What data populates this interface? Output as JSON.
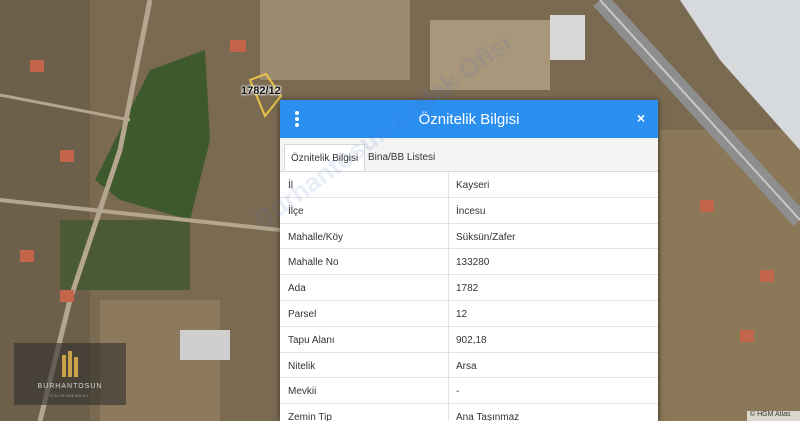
{
  "map": {
    "parcel_label": "1782/12",
    "logo_name": "BURHANTOSUN",
    "logo_sub": "GAYRİMENKUL",
    "attribution": "© HGM Atlas",
    "watermark": "Burhantosun Emlak Ofisi"
  },
  "panel": {
    "title": "Öznitelik Bilgisi",
    "menu_icon": "kebab-menu-icon",
    "close_icon": "close-icon",
    "close_glyph": "×",
    "colors": {
      "header": "#2b8ff0",
      "parcel_outline": "#e8c247"
    },
    "tabs": [
      {
        "label": "Öznitelik Bilgisi",
        "active": true
      },
      {
        "label": "Bina/BB Listesi",
        "active": false
      }
    ],
    "rows": [
      {
        "key": "İl",
        "value": "Kayseri"
      },
      {
        "key": "İlçe",
        "value": "İncesu"
      },
      {
        "key": "Mahalle/Köy",
        "value": "Süksün/Zafer"
      },
      {
        "key": "Mahalle No",
        "value": "133280"
      },
      {
        "key": "Ada",
        "value": "1782"
      },
      {
        "key": "Parsel",
        "value": "12"
      },
      {
        "key": "Tapu Alanı",
        "value": "902,18"
      },
      {
        "key": "Nitelik",
        "value": "Arsa"
      },
      {
        "key": "Mevkii",
        "value": "-"
      },
      {
        "key": "Zemin Tip",
        "value": "Ana Taşınmaz"
      }
    ]
  }
}
